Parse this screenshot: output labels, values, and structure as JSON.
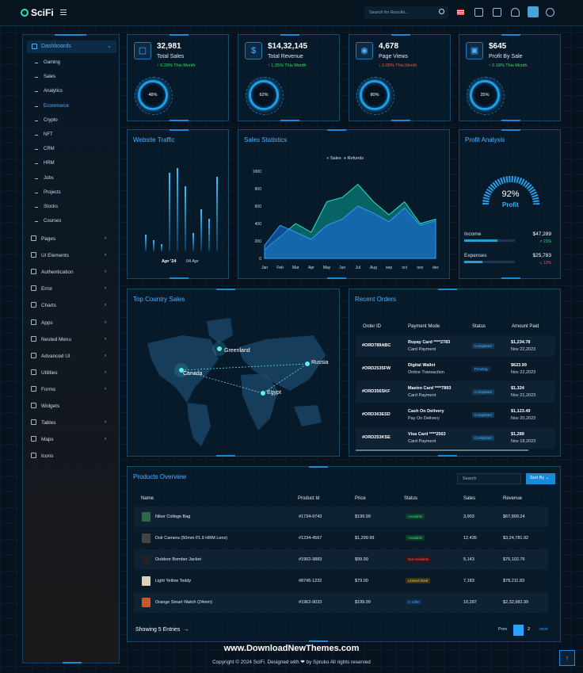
{
  "header": {
    "brand": "SciFi",
    "search_placeholder": "Search for Results...",
    "icons": [
      "menu-icon",
      "search-icon",
      "flag-icon",
      "fullscreen-icon",
      "apps-icon",
      "bell-icon",
      "avatar",
      "gear-icon"
    ]
  },
  "sidebar": {
    "active": "Dashboards",
    "subitems": [
      "Gaming",
      "Sales",
      "Analytics",
      "Ecommerce",
      "Crypto",
      "NFT",
      "CRM",
      "HRM",
      "Jobs",
      "Projects",
      "Stocks",
      "Courses"
    ],
    "active_sub": "Ecommerce",
    "items": [
      {
        "label": "Pages",
        "chevron": true
      },
      {
        "label": "UI Elements",
        "chevron": true
      },
      {
        "label": "Authentication",
        "chevron": true
      },
      {
        "label": "Error",
        "chevron": true
      },
      {
        "label": "Charts",
        "chevron": true
      },
      {
        "label": "Apps",
        "chevron": true
      },
      {
        "label": "Nested Menu",
        "chevron": true
      },
      {
        "label": "Advanced UI",
        "chevron": true
      },
      {
        "label": "Utilities",
        "chevron": true
      },
      {
        "label": "Forms",
        "chevron": true
      },
      {
        "label": "Widgets",
        "chevron": false
      },
      {
        "label": "Tables",
        "chevron": true
      },
      {
        "label": "Maps",
        "chevron": true
      },
      {
        "label": "Icons",
        "chevron": false
      }
    ]
  },
  "kpis": [
    {
      "value": "32,981",
      "label": "Total Sales",
      "change": "↑ 0.29% This Month",
      "up": true,
      "ring": "48%",
      "icon": "briefcase-icon"
    },
    {
      "value": "$14,32,145",
      "label": "Total Revenue",
      "change": "↑ 1.25% This Month",
      "up": true,
      "ring": "62%",
      "icon": "dollar-icon"
    },
    {
      "value": "4,678",
      "label": "Page Views",
      "change": "↓ 0.05% This Month",
      "up": false,
      "ring": "80%",
      "icon": "eye-icon"
    },
    {
      "value": "$645",
      "label": "Profit By Sale",
      "change": "↑ 0.18% This Month",
      "up": true,
      "ring": "25%",
      "icon": "wallet-icon"
    }
  ],
  "traffic": {
    "title": "Website Traffic",
    "x_labels": [
      "Apr '24",
      "04 Apr"
    ]
  },
  "chart_data": {
    "type": "area",
    "title": "Sales Statistics",
    "categories": [
      "Jan",
      "Feb",
      "Mar",
      "Apr",
      "May",
      "Jun",
      "Jul",
      "Aug",
      "sep",
      "oct",
      "nov",
      "dec"
    ],
    "series": [
      {
        "name": "Sales",
        "values": [
          150,
          380,
          300,
          220,
          380,
          450,
          600,
          520,
          420,
          580,
          380,
          430
        ]
      },
      {
        "name": "Refunds",
        "values": [
          100,
          250,
          400,
          300,
          650,
          700,
          850,
          650,
          500,
          650,
          400,
          450
        ]
      }
    ],
    "yticks": [
      0,
      200,
      400,
      600,
      800,
      1000
    ],
    "ylim": [
      0,
      1000
    ],
    "legend": "top"
  },
  "profit": {
    "title": "Profit Analysis",
    "percent": "92%",
    "label": "Profit",
    "income_label": "Income",
    "income": "$47,289",
    "income_change": "↗ 21%",
    "expenses_label": "Expenses",
    "expenses": "$25,783",
    "expenses_change": "↘ 12%"
  },
  "map": {
    "title": "Top Country Sales",
    "countries": [
      "Greenland",
      "Canada",
      "Russia",
      "Egypt"
    ]
  },
  "orders": {
    "title": "Recent Orders",
    "headers": [
      "Order ID",
      "Payment Mode",
      "Status",
      "Amount Paid"
    ],
    "rows": [
      {
        "id": "#ORD789ABC",
        "pm": "Rupay Card ****2783",
        "pm2": "Card Payment",
        "status": "Completed",
        "amount": "$1,234.78",
        "date": "Nov 22,2023"
      },
      {
        "id": "#ORD2535FW",
        "pm": "Digital Wallet",
        "pm2": "Online Transaction",
        "status": "Pending",
        "amount": "$623.99",
        "date": "Nov 22,2023"
      },
      {
        "id": "#ORD356SKF",
        "pm": "Mastro Card ****7893",
        "pm2": "Card Payment",
        "status": "Completed",
        "amount": "$1,324",
        "date": "Nov 21,2023"
      },
      {
        "id": "#ORD363ESD",
        "pm": "Cash On Delivery",
        "pm2": "Pay On Delivery",
        "status": "Completed",
        "amount": "$1,123.49",
        "date": "Nov 20,2023"
      },
      {
        "id": "#ORD253KSE",
        "pm": "Visa Card ****2563",
        "pm2": "Card Payment",
        "status": "Completed",
        "amount": "$1,289",
        "date": "Nov 18,2023"
      }
    ]
  },
  "products": {
    "title": "Products Overview",
    "search_placeholder": "Search",
    "sort_label": "Sort By",
    "headers": [
      "Name",
      "Product Id",
      "Price",
      "Status",
      "Sales",
      "Revenue"
    ],
    "rows": [
      {
        "name": "Niker College Bag",
        "pid": "#1734-9743",
        "price": "$199.99",
        "status": "Available",
        "sales": "3,903",
        "revenue": "$67,899.24",
        "color": "#2a6a4a"
      },
      {
        "name": "Dslr Camera (50mm f/1.9 HRM Lens)",
        "pid": "#1234-4567",
        "price": "$1,299.99",
        "status": "Available",
        "sales": "12,435",
        "revenue": "$3,24,781.92",
        "color": "#444"
      },
      {
        "name": "Outdoor Bomber Jacket",
        "pid": "#1902-9883",
        "price": "$99.99",
        "status": "Not Available",
        "sales": "5,143",
        "revenue": "$76,102.76",
        "color": "#222"
      },
      {
        "name": "Light Yellow Teddy",
        "pid": "#8745-1232",
        "price": "$79.00",
        "status": "Limited Deal",
        "sales": "7,183",
        "revenue": "$78,211.83",
        "color": "#dcd2b8"
      },
      {
        "name": "Orange Smart Watch (24mm)",
        "pid": "#1962-9033",
        "price": "$199.99",
        "status": "In Offer",
        "sales": "10,287",
        "revenue": "$2,32,982.99",
        "color": "#c85a2a"
      }
    ],
    "footer": "Showing 5 Entries",
    "pagination": {
      "prev": "Prev",
      "pages": [
        "1",
        "2"
      ],
      "current": "1",
      "next": "next"
    }
  },
  "watermark": "www.DownloadNewThemes.com",
  "copyright": "Copyright © 2024 SciFi. Designed with ❤ by Spruko All rights reserved"
}
